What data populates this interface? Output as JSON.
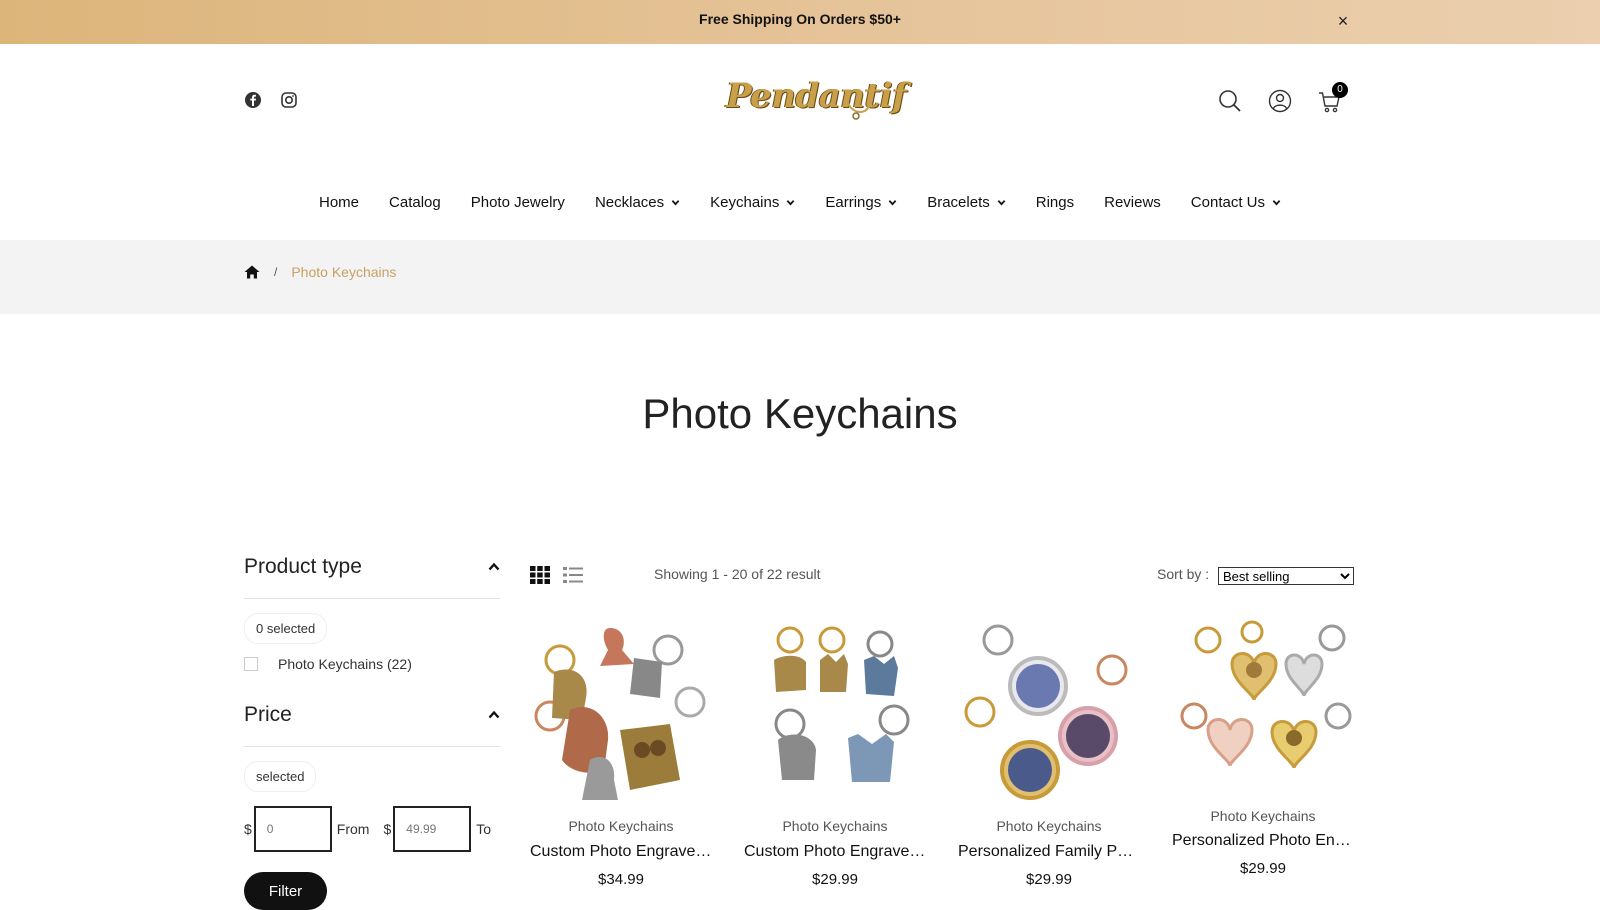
{
  "announcement": {
    "text": "Free Shipping On Orders $50+",
    "close_label": "×"
  },
  "header": {
    "logo_text": "Pendantif",
    "social": [
      "facebook-icon",
      "instagram-icon"
    ],
    "cart_count": "0"
  },
  "nav": {
    "items": [
      {
        "label": "Home",
        "has_dropdown": false
      },
      {
        "label": "Catalog",
        "has_dropdown": false
      },
      {
        "label": "Photo Jewelry",
        "has_dropdown": false
      },
      {
        "label": "Necklaces",
        "has_dropdown": true
      },
      {
        "label": "Keychains",
        "has_dropdown": true
      },
      {
        "label": "Earrings",
        "has_dropdown": true
      },
      {
        "label": "Bracelets",
        "has_dropdown": true
      },
      {
        "label": "Rings",
        "has_dropdown": false
      },
      {
        "label": "Reviews",
        "has_dropdown": false
      },
      {
        "label": "Contact Us",
        "has_dropdown": true
      }
    ]
  },
  "breadcrumb": {
    "separator": "/",
    "current": "Photo Keychains"
  },
  "page_title": "Photo Keychains",
  "sidebar": {
    "product_type": {
      "title": "Product type",
      "selected": "0 selected",
      "options": [
        {
          "label": "Photo Keychains (22)"
        }
      ]
    },
    "price": {
      "title": "Price",
      "selected": "selected",
      "currency": "$",
      "from_placeholder": "0",
      "from_label": "From",
      "to_placeholder": "49.99",
      "to_label": "To",
      "filter_label": "Filter"
    }
  },
  "toolbar": {
    "showing": "Showing 1 - 20 of 22 result",
    "sort_label": "Sort by :",
    "sort_value": "Best selling"
  },
  "products": [
    {
      "type": "Photo Keychains",
      "name": "Custom Photo Engraved Keychain",
      "price": "$34.99"
    },
    {
      "type": "Photo Keychains",
      "name": "Custom Photo Engraved Pet Keychain",
      "price": "$29.99"
    },
    {
      "type": "Photo Keychains",
      "name": "Personalized Family Photo Keychain",
      "price": "$29.99"
    },
    {
      "type": "Photo Keychains",
      "name": "Personalized Photo Engraved Heart Keychain",
      "price": "$29.99"
    }
  ],
  "colors": {
    "accent_gold": "#c9a063",
    "announce_bg": "#dcb57a",
    "breadcrumb_bg": "#f3f3f3"
  }
}
